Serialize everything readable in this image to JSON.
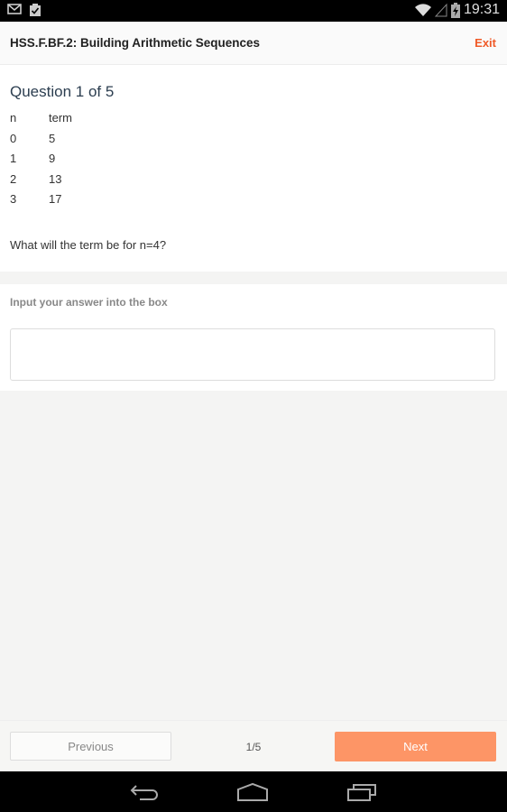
{
  "status_bar": {
    "left_icons": [
      "gmail-icon",
      "clipboard-check-icon"
    ],
    "right_icons": [
      "wifi-icon",
      "cell-signal-icon",
      "battery-charging-icon"
    ],
    "time": "19:31"
  },
  "app_bar": {
    "title": "HSS.F.BF.2: Building Arithmetic Sequences",
    "exit_label": "Exit"
  },
  "question": {
    "title": "Question 1 of 5",
    "table": {
      "headers": [
        "n",
        "term"
      ],
      "rows": [
        [
          "0",
          "5"
        ],
        [
          "1",
          "9"
        ],
        [
          "2",
          "13"
        ],
        [
          "3",
          "17"
        ]
      ]
    },
    "prompt": "What will the term be for n=4?"
  },
  "answer": {
    "label": "Input your answer into the box",
    "value": "",
    "placeholder": ""
  },
  "footer": {
    "previous_label": "Previous",
    "page_indicator": "1/5",
    "next_label": "Next"
  },
  "colors": {
    "accent": "#f05a28",
    "next_button": "#fd9566"
  }
}
